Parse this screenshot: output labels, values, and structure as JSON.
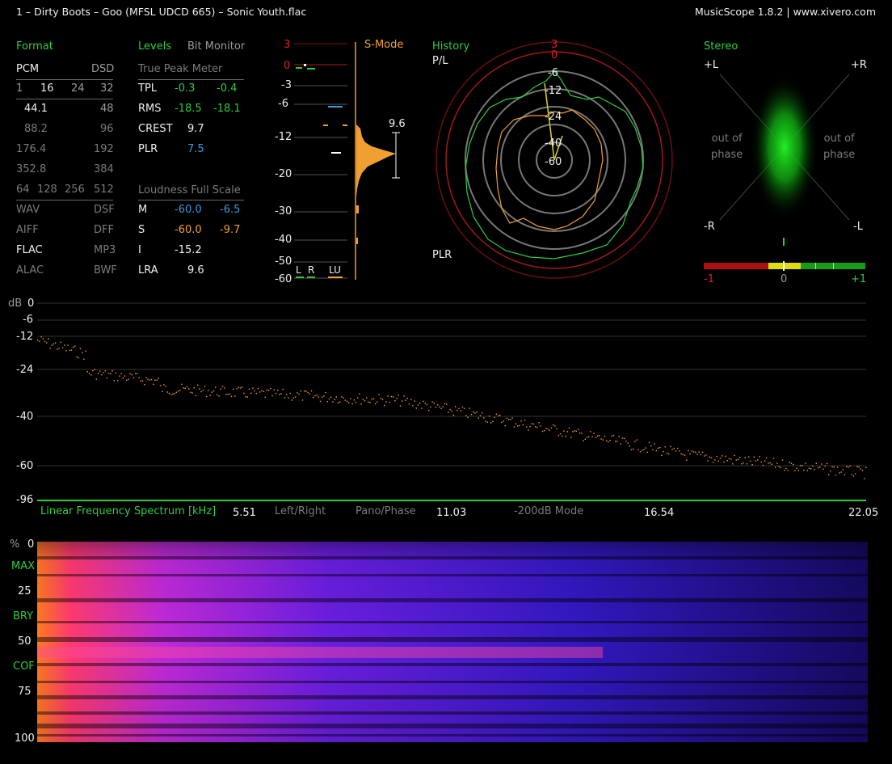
{
  "titlebar": {
    "track": "1 – Dirty Boots – Goo (MFSL UDCD 665) – Sonic Youth.flac",
    "app": "MusicScope 1.8.2 | www.xivero.com"
  },
  "format": {
    "header": "Format",
    "pcm": "PCM",
    "dsd": "DSD",
    "bits": [
      "1",
      "16",
      "24",
      "32"
    ],
    "rates": [
      [
        "44.1",
        "48"
      ],
      [
        "88.2",
        "96"
      ],
      [
        "176.4",
        "192"
      ],
      [
        "352.8",
        "384"
      ]
    ],
    "dsd_rates": [
      "64",
      "128",
      "256",
      "512"
    ],
    "types": [
      [
        "WAV",
        "DSF"
      ],
      [
        "AIFF",
        "DFF"
      ],
      [
        "FLAC",
        "MP3"
      ],
      [
        "ALAC",
        "BWF"
      ]
    ]
  },
  "levels": {
    "header": "Levels",
    "bit_monitor": "Bit Monitor",
    "true_peak_meter": "True Peak Meter",
    "rows": [
      {
        "label": "TPL",
        "l": "-0.3",
        "r": "-0.4"
      },
      {
        "label": "RMS",
        "l": "-18.5",
        "r": "-18.1"
      },
      {
        "label": "CREST",
        "l": "9.7",
        "r": ""
      },
      {
        "label": "PLR",
        "l": "7.5",
        "r": ""
      }
    ],
    "loudness_header": "Loudness Full Scale",
    "loudness": [
      {
        "label": "M",
        "a": "-60.0",
        "b": "-6.5"
      },
      {
        "label": "S",
        "a": "-60.0",
        "b": "-9.7"
      },
      {
        "label": "I",
        "a": "-15.2",
        "b": ""
      },
      {
        "label": "LRA",
        "a": "9.6",
        "b": ""
      }
    ]
  },
  "meter": {
    "smode": "S-Mode",
    "scale": [
      "3",
      "0",
      "-3",
      "-6",
      "-12",
      "-20",
      "-30",
      "-40",
      "-50",
      "-60"
    ],
    "plr_value": "9.6",
    "channels": [
      "L",
      "R",
      "LU"
    ]
  },
  "history": {
    "header": "History",
    "pl_label": "P/L",
    "plr_label": "PLR",
    "rings": [
      "3",
      "0",
      "-6",
      "-12",
      "-24",
      "-40",
      "-60"
    ]
  },
  "stereo": {
    "header": "Stereo",
    "corners": [
      "+L",
      "+R",
      "-R",
      "-L"
    ],
    "out_of_phase_left": "out of\nphase",
    "out_of_phase_right": "out of\nphase",
    "correlation_scale": [
      "-1",
      "0",
      "+1"
    ]
  },
  "spectrum": {
    "db_label": "dB",
    "db_ticks": [
      "0",
      "-6",
      "-12",
      "-24",
      "-40",
      "-60",
      "-96"
    ],
    "title": "Linear Frequency Spectrum [kHz]",
    "freq_ticks": [
      "5.51",
      "11.03",
      "16.54",
      "22.05"
    ],
    "mode_buttons": [
      "Left/Right",
      "Pano/Phase",
      "-200dB Mode"
    ]
  },
  "spectrogram": {
    "pct_label": "%",
    "ticks": [
      "0",
      "25",
      "50",
      "75",
      "100"
    ],
    "markers": [
      "MAX",
      "BRY",
      "COF"
    ]
  },
  "colors": {
    "green": "#2ecc40",
    "orange": "#f0a030",
    "red": "#e02020",
    "blue": "#3a9ad9"
  }
}
